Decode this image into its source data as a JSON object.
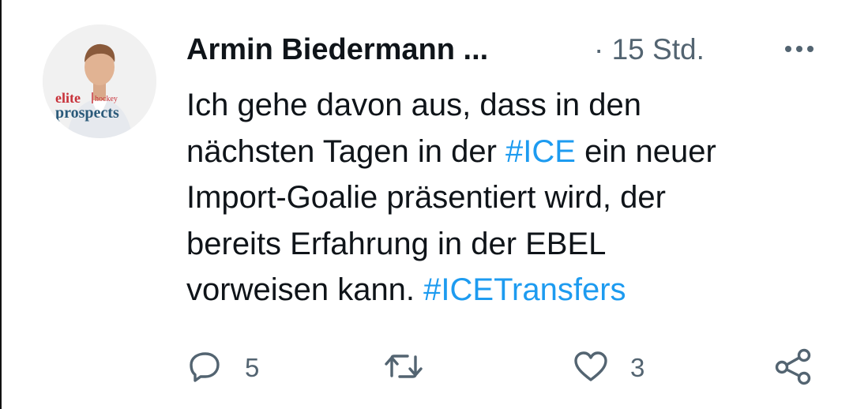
{
  "tweet": {
    "author_name": "Armin Biedermann ...",
    "separator_time": "· 15 Std.",
    "more_icon": "more-horizontal-icon",
    "avatar": {
      "logo_line1": "elite",
      "logo_line1_small": "hockey",
      "logo_line2": "prospects"
    },
    "text_lines": [
      {
        "plain": "Ich gehe davon aus, dass in den",
        "hashtag": "",
        "after": ""
      },
      {
        "plain": "nächsten Tagen in der ",
        "hashtag": "#ICE",
        "after": " ein neuer"
      },
      {
        "plain": "Import-Goalie präsentiert wird, der",
        "hashtag": "",
        "after": ""
      },
      {
        "plain": "bereits Erfahrung in der EBEL",
        "hashtag": "",
        "after": ""
      },
      {
        "plain": "vorweisen kann. ",
        "hashtag": "#ICETransfers",
        "after": ""
      }
    ],
    "actions": {
      "reply": {
        "icon": "reply-icon",
        "count": "5"
      },
      "retweet": {
        "icon": "retweet-icon",
        "count": ""
      },
      "like": {
        "icon": "heart-icon",
        "count": "3"
      },
      "share": {
        "icon": "share-icon",
        "count": ""
      }
    },
    "colors": {
      "text": "#0f1419",
      "secondary": "#536471",
      "link": "#1d9bf0",
      "logo_red": "#c8323a",
      "logo_blue": "#2b5a7a"
    }
  }
}
